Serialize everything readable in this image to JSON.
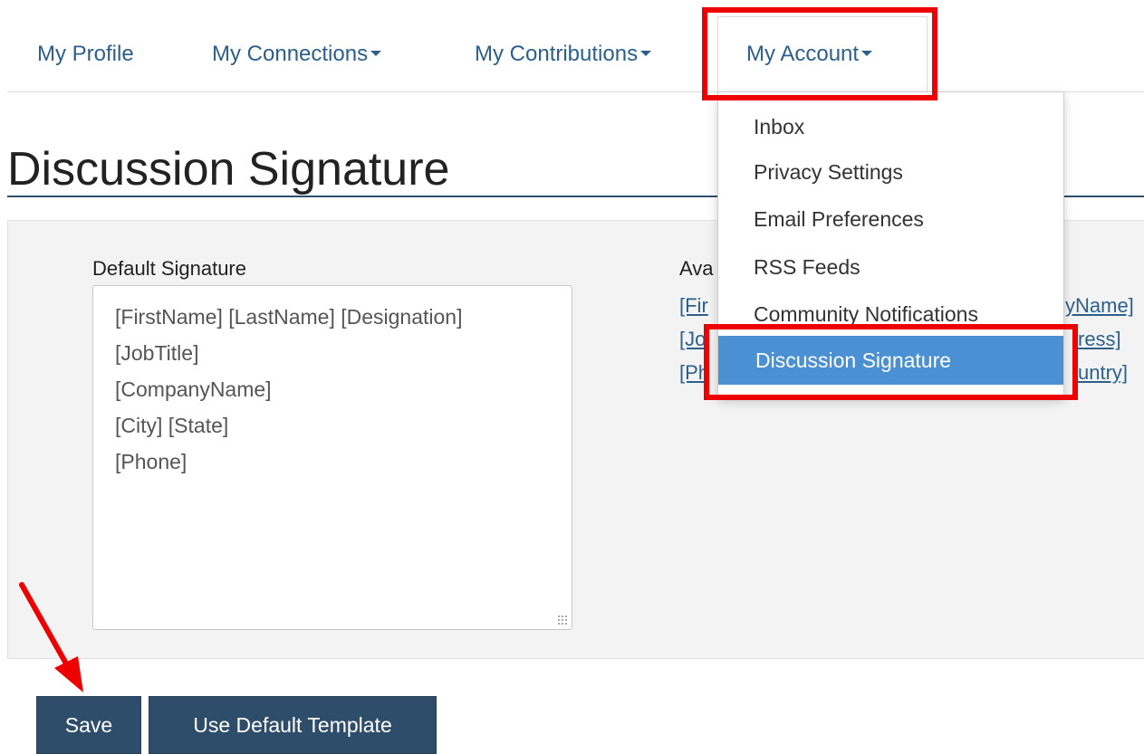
{
  "nav": {
    "items": [
      {
        "label": "My Profile",
        "has_caret": false
      },
      {
        "label": "My Connections",
        "has_caret": true
      },
      {
        "label": "My Contributions",
        "has_caret": true
      }
    ],
    "account": {
      "label": "My Account",
      "has_caret": true
    }
  },
  "dropdown": {
    "items": [
      {
        "label": "Inbox"
      },
      {
        "label": "Privacy Settings"
      },
      {
        "label": "Email Preferences"
      },
      {
        "label": "RSS Feeds"
      },
      {
        "label": "Community Notifications"
      }
    ],
    "active_label": "Discussion Signature"
  },
  "page": {
    "title": "Discussion Signature"
  },
  "signature": {
    "label": "Default Signature",
    "lines": [
      "[FirstName] [LastName] [Designation]",
      "[JobTitle]",
      "[CompanyName]",
      "[City] [State]",
      "[Phone]"
    ]
  },
  "available": {
    "label_visible": "Ava",
    "tokens_left": [
      "[Fir",
      "[Jo",
      "[Ph"
    ],
    "tokens_right": [
      "yName]",
      "ress]",
      "untry]"
    ]
  },
  "buttons": {
    "save": "Save",
    "use_default": "Use Default Template"
  },
  "colors": {
    "link": "#2b5f8c",
    "button_bg": "#2e4d6b",
    "menu_active_bg": "#4a90d2",
    "annotation": "#ee0000"
  }
}
